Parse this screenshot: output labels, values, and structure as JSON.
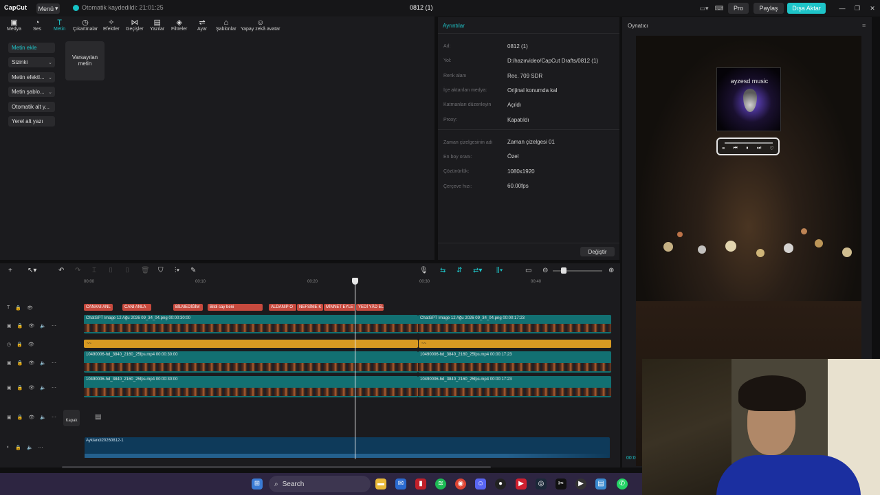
{
  "app": {
    "logo": "CapCut",
    "menu_label": "Menü",
    "autosave": "Otomatik kaydedildi: 21:01:25",
    "project_title": "0812 (1)",
    "pro_label": "Pro",
    "share_label": "Paylaş",
    "export_label": "Dışa Aktar"
  },
  "toolbar": [
    {
      "label": "Medya",
      "icon": "media-icon"
    },
    {
      "label": "Ses",
      "icon": "audio-icon"
    },
    {
      "label": "Metin",
      "icon": "text-icon"
    },
    {
      "label": "Çıkartmalar",
      "icon": "sticker-icon"
    },
    {
      "label": "Efektler",
      "icon": "effects-icon"
    },
    {
      "label": "Geçişler",
      "icon": "transitions-icon"
    },
    {
      "label": "Yazılar",
      "icon": "captions-icon"
    },
    {
      "label": "Filtreler",
      "icon": "filters-icon"
    },
    {
      "label": "Ayar",
      "icon": "adjust-icon"
    },
    {
      "label": "Şablonlar",
      "icon": "templates-icon"
    },
    {
      "label": "Yapay zekâ avatar",
      "icon": "avatar-icon"
    }
  ],
  "text_nav": [
    {
      "label": "Metin ekle"
    },
    {
      "label": "Sizinki"
    },
    {
      "label": "Metin efektl..."
    },
    {
      "label": "Metin şablo..."
    },
    {
      "label": "Otomatik alt y..."
    },
    {
      "label": "Yerel alt yazı"
    }
  ],
  "library": {
    "card_label": "Varsayılan metin"
  },
  "details": {
    "title": "Ayrıntılar",
    "rows": [
      {
        "label": "Ad:",
        "value": "0812 (1)"
      },
      {
        "label": "Yol:",
        "value": "D:/hazırvideo/CapCut Drafts/0812 (1)"
      },
      {
        "label": "Renk alanı",
        "value": "Rec. 709 SDR"
      },
      {
        "label": "İçe aktarılan medya:",
        "value": "Orijinal konumda kal"
      },
      {
        "label": "Katmanları düzenleyin",
        "value": "Açıldı"
      },
      {
        "label": "Proxy:",
        "value": "Kapatıldı"
      }
    ],
    "rows2": [
      {
        "label": "Zaman çizelgesinin adı",
        "value": "Zaman çizelgesi 01"
      },
      {
        "label": "En boy oranı:",
        "value": "Özel"
      },
      {
        "label": "Çözünürlük:",
        "value": "1080x1920"
      },
      {
        "label": "Çerçeve hızı:",
        "value": "60.00fps"
      }
    ],
    "change_button": "Değiştir"
  },
  "player": {
    "title": "Oynatıcı",
    "cover_text": "ayzesd music",
    "timecode": "00:0"
  },
  "timeline": {
    "ruler": [
      "00:00",
      "00:10",
      "00:20",
      "00:30",
      "00:40"
    ],
    "text_segments": [
      "CANANI ANL",
      "CANI ANLA",
      "BİLMEDİĞİM",
      "Bildi say beni",
      "ALDANIP O",
      "NEFSİME K",
      "MİNNET EYLE",
      "YEDİ YÂD EL"
    ],
    "video1": {
      "clip_a": "ChatGPT Image 12 Ağu 2026 09_34_04.png   00:00:30:00",
      "clip_b": "ChatGPT Image 12 Ağu 2026 09_34_04.png   00:00:17:23"
    },
    "yellow": {
      "a": "~~",
      "b": "~~"
    },
    "video2": {
      "clip_a": "10490006-hd_3840_2160_25fps.mp4   00:00:30:00",
      "clip_b": "10490006-hd_3840_2160_25fps.mp4   00:00:17:23"
    },
    "video3": {
      "clip_a": "10490006-hd_3840_2160_25fps.mp4   00:00:30:00",
      "clip_b": "10490006-hd_3840_2160_25fps.mp4   00:00:17:23"
    },
    "cover_label": "Kapak",
    "audio": "Ayklandi20260812-1"
  },
  "taskbar": {
    "search_placeholder": "Search"
  },
  "colors": {
    "accent": "#1ec4c8",
    "text_clip": "#c74a3e",
    "video_clip": "#127072",
    "effect_clip": "#d79a22",
    "audio_clip": "#0e3a5a"
  }
}
